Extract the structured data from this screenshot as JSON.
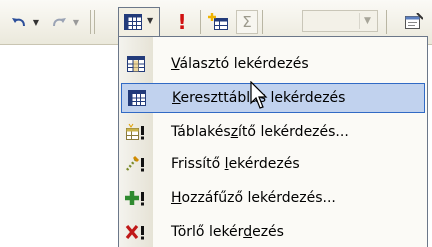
{
  "toolbar": {
    "buttons": [
      {
        "name": "undo",
        "icon": "undo-icon"
      },
      {
        "name": "redo",
        "icon": "redo-icon"
      },
      {
        "name": "query-type",
        "icon": "crosstab-grid-icon"
      },
      {
        "name": "run",
        "icon": "exclamation-icon"
      },
      {
        "name": "show-table",
        "icon": "add-table-icon"
      },
      {
        "name": "totals",
        "icon": "sigma-icon"
      },
      {
        "name": "top-values",
        "value": ""
      },
      {
        "name": "properties",
        "icon": "properties-icon"
      }
    ]
  },
  "menu": {
    "items": [
      {
        "pre": "",
        "acc": "V",
        "post": "álasztó lekérdezés",
        "icon": "select-query-icon",
        "highlighted": false
      },
      {
        "pre": "",
        "acc": "K",
        "post": "ereszttáblás lekérdezés",
        "icon": "crosstab-query-icon",
        "highlighted": true
      },
      {
        "pre": "Táblakés",
        "acc": "z",
        "post": "ítő lekérdezés...",
        "icon": "make-table-query-icon",
        "highlighted": false
      },
      {
        "pre": "Frissítő ",
        "acc": "l",
        "post": "ekérdezés",
        "icon": "update-query-icon",
        "highlighted": false
      },
      {
        "pre": "",
        "acc": "H",
        "post": "ozzáfűző lekérdezés...",
        "icon": "append-query-icon",
        "highlighted": false
      },
      {
        "pre": "Törlő lekér",
        "acc": "d",
        "post": "ezés",
        "icon": "delete-query-icon",
        "highlighted": false
      }
    ]
  },
  "colors": {
    "highlight": "#c1d2ee",
    "highlight_border": "#316ac5",
    "exclamation": "#d01010"
  }
}
